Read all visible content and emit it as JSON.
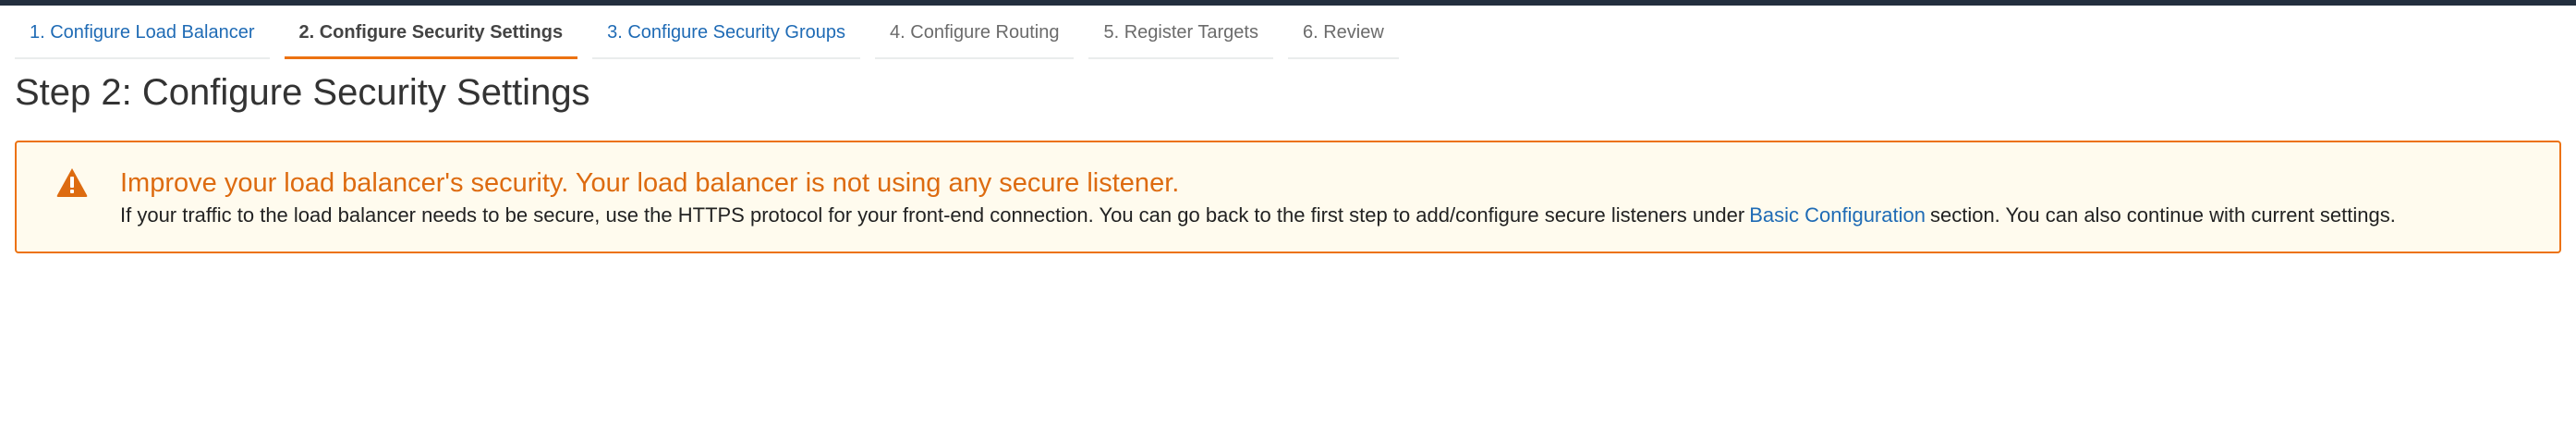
{
  "wizard": {
    "tabs": [
      {
        "label": "1. Configure Load Balancer",
        "state": "link"
      },
      {
        "label": "2. Configure Security Settings",
        "state": "active"
      },
      {
        "label": "3. Configure Security Groups",
        "state": "link"
      },
      {
        "label": "4. Configure Routing",
        "state": "disabled"
      },
      {
        "label": "5. Register Targets",
        "state": "disabled"
      },
      {
        "label": "6. Review",
        "state": "disabled"
      }
    ]
  },
  "page": {
    "title": "Step 2: Configure Security Settings"
  },
  "alert": {
    "icon": "warning-icon",
    "title": "Improve your load balancer's security. Your load balancer is not using any secure listener.",
    "body_before": "If your traffic to the load balancer needs to be secure, use the HTTPS protocol for your front-end connection. You can go back to the first step to add/configure secure listeners under",
    "link_text": "Basic Configuration",
    "body_after": "section. You can also continue with current settings."
  },
  "colors": {
    "accent_orange": "#ec7211",
    "link_blue": "#1f6bb5",
    "alert_background": "#fffbee",
    "top_bar": "#232f3e"
  }
}
